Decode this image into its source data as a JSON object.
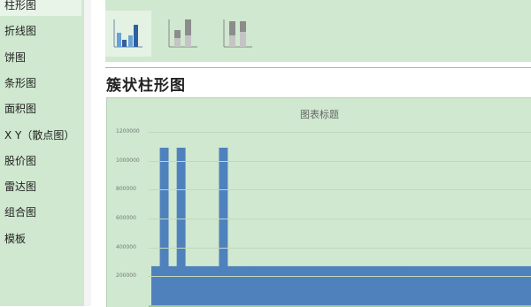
{
  "sidebar": {
    "items": [
      {
        "label": "柱形图",
        "selected": true
      },
      {
        "label": "折线图"
      },
      {
        "label": "饼图"
      },
      {
        "label": "条形图"
      },
      {
        "label": "面积图"
      },
      {
        "label": "X Y（散点图）"
      },
      {
        "label": "股价图"
      },
      {
        "label": "雷达图"
      },
      {
        "label": "组合图"
      },
      {
        "label": "模板"
      }
    ]
  },
  "subtypes": [
    {
      "icon": "clustered-column-icon",
      "selected": true
    },
    {
      "icon": "stacked-column-icon"
    },
    {
      "icon": "100-percent-stacked-column-icon"
    }
  ],
  "section_title": "簇状柱形图",
  "chart_data": {
    "type": "bar",
    "title": "图表标题",
    "ylim": [
      0,
      1200000
    ],
    "yticks": [
      200000,
      400000,
      600000,
      800000,
      1000000,
      1200000
    ],
    "ytick_labels": [
      "200000",
      "400000",
      "600000",
      "800000",
      "1000000",
      "1200000"
    ],
    "values": [
      270000,
      1090000,
      270000,
      1090000,
      270000,
      270000,
      270000,
      270000,
      1090000,
      270000,
      270000,
      270000,
      270000,
      270000,
      270000,
      270000,
      270000,
      270000,
      270000,
      270000,
      270000,
      270000,
      270000,
      270000,
      270000,
      270000,
      270000,
      270000,
      270000,
      270000,
      270000,
      270000,
      270000,
      270000,
      270000,
      270000,
      270000,
      270000,
      270000,
      270000,
      270000,
      270000,
      270000,
      270000,
      270000
    ],
    "bar_color": "#4f81bd"
  },
  "colors": {
    "sidebar_bg": "#cfe8cf",
    "chart_bg": "#cfe8cf",
    "bar": "#4f81bd"
  }
}
